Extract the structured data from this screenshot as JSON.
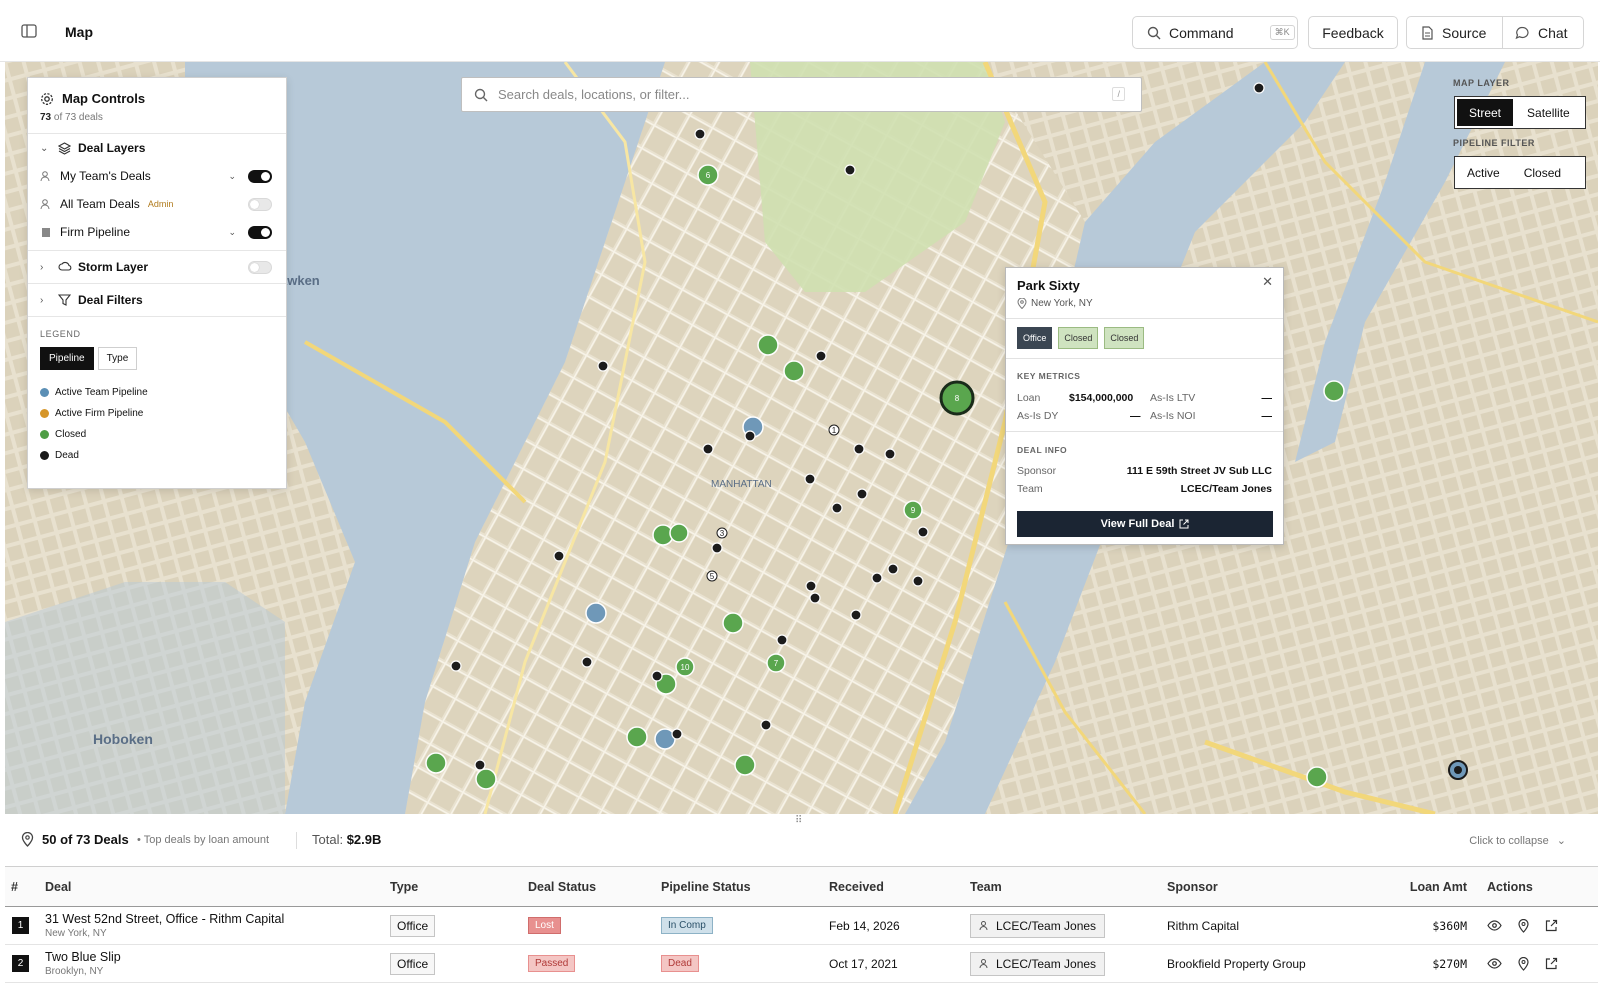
{
  "topbar": {
    "title": "Map",
    "command_label": "Command",
    "command_kbd": "⌘K",
    "feedback_label": "Feedback",
    "source_label": "Source",
    "chat_label": "Chat"
  },
  "controls": {
    "title": "Map Controls",
    "count_shown": "73",
    "count_of": "of",
    "count_total": "73 deals",
    "deal_layers": "Deal Layers",
    "layers": [
      {
        "label": "My Team's Deals",
        "on": true
      },
      {
        "label": "All Team Deals",
        "badge": "Admin",
        "on": false
      },
      {
        "label": "Firm Pipeline",
        "on": true
      }
    ],
    "storm_layer": "Storm Layer",
    "deal_filters": "Deal Filters",
    "legend_title": "LEGEND",
    "legend_tabs": [
      "Pipeline",
      "Type"
    ],
    "legend_items": [
      {
        "label": "Active Team Pipeline",
        "color": "#5b8fb5"
      },
      {
        "label": "Active Firm Pipeline",
        "color": "#d6962a"
      },
      {
        "label": "Closed",
        "color": "#4f9e45"
      },
      {
        "label": "Dead",
        "color": "#1a1a1a"
      }
    ]
  },
  "search": {
    "placeholder": "Search deals, locations, or filter...",
    "shortcut": "/"
  },
  "map_layer": {
    "title": "MAP LAYER",
    "options": [
      "Street",
      "Satellite"
    ],
    "selected": "Street"
  },
  "pipeline_filter": {
    "title": "PIPELINE FILTER",
    "options": [
      "Active",
      "Closed"
    ]
  },
  "map_labels": {
    "hoboken": "Hoboken",
    "manhattan": "MANHATTAN",
    "weehawken": "awken"
  },
  "popup": {
    "title": "Park Sixty",
    "location": "New York, NY",
    "tags": [
      "Office",
      "Closed",
      "Closed"
    ],
    "key_metrics_title": "KEY METRICS",
    "loan_label": "Loan",
    "loan_value": "$154,000,000",
    "ltv_label": "As-Is LTV",
    "ltv_value": "—",
    "dy_label": "As-Is DY",
    "dy_value": "—",
    "noi_label": "As-Is NOI",
    "noi_value": "—",
    "deal_info_title": "DEAL INFO",
    "sponsor_label": "Sponsor",
    "sponsor_value": "111 E 59th Street JV Sub LLC",
    "team_label": "Team",
    "team_value": "LCEC/Team Jones",
    "view_label": "View Full Deal"
  },
  "bottom": {
    "count": "50 of 73 Deals",
    "note": "• Top deals by loan amount",
    "total_label": "Total:",
    "total_value": "$2.9B",
    "collapse_label": "Click to collapse"
  },
  "table": {
    "headers": [
      "#",
      "Deal",
      "Type",
      "Deal Status",
      "Pipeline Status",
      "Received",
      "Team",
      "Sponsor",
      "Loan Amt",
      "Actions"
    ],
    "rows": [
      {
        "num": "1",
        "deal": "31 West 52nd Street, Office - Rithm Capital",
        "loc": "New York, NY",
        "type": "Office",
        "deal_status": "Lost",
        "pipeline_status": "In Comp",
        "received": "Feb 14, 2026",
        "team": "LCEC/Team Jones",
        "sponsor": "Rithm Capital",
        "amt": "$360M"
      },
      {
        "num": "2",
        "deal": "Two Blue Slip",
        "loc": "Brooklyn, NY",
        "type": "Office",
        "deal_status": "Passed",
        "pipeline_status": "Dead",
        "received": "Oct 17, 2021",
        "team": "LCEC/Team Jones",
        "sponsor": "Brookfield Property Group",
        "amt": "$270M"
      }
    ]
  },
  "map_markers": {
    "cluster_labels": [
      "6",
      "8",
      "9",
      "1",
      "3",
      "5",
      "10",
      "7"
    ]
  }
}
